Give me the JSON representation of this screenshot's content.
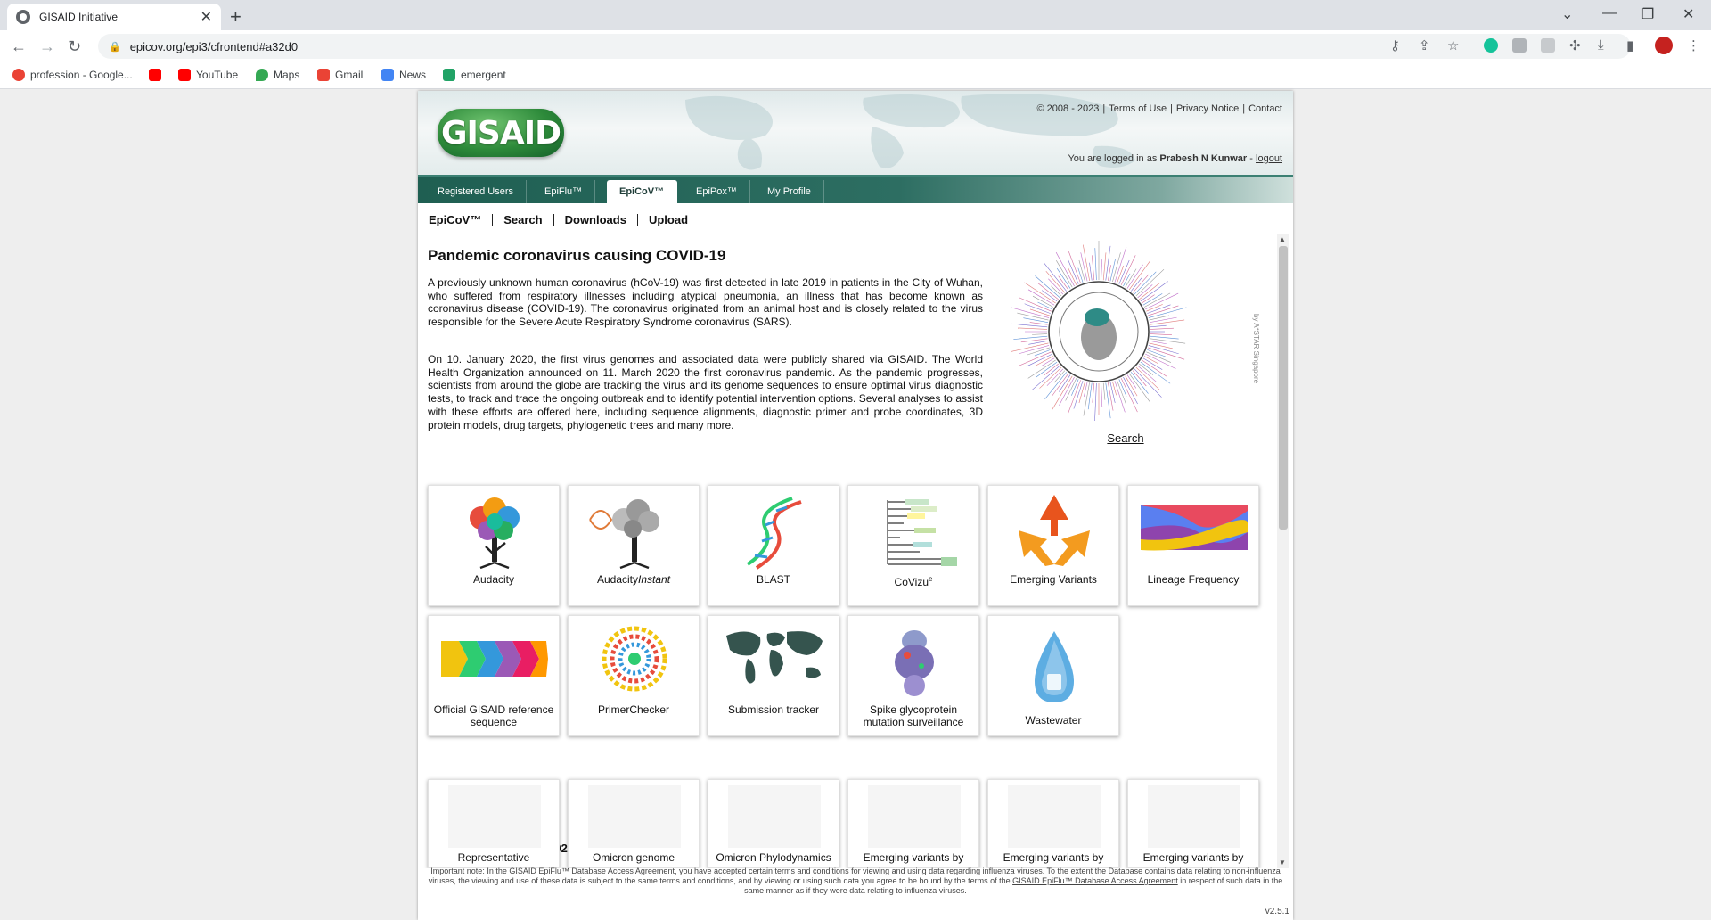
{
  "browser": {
    "tab_title": "GISAID Initiative",
    "url": "epicov.org/epi3/cfrontend#a32d0",
    "bookmarks": [
      {
        "label": "profession - Google...",
        "color": "#ea4335"
      },
      {
        "label": "",
        "color": "#ff0000"
      },
      {
        "label": "YouTube",
        "color": "#ff0000"
      },
      {
        "label": "Maps",
        "color": "#34a853"
      },
      {
        "label": "Gmail",
        "color": "#ea4335"
      },
      {
        "label": "News",
        "color": "#4285f4"
      },
      {
        "label": "emergent",
        "color": "#21a366"
      }
    ]
  },
  "header": {
    "logo": "GISAID",
    "copyright": "© 2008 - 2023",
    "terms": "Terms of Use",
    "privacy": "Privacy Notice",
    "contact": "Contact",
    "logged_in_prefix": "You are logged in as",
    "user": "Prabesh N Kunwar",
    "logout_sep": "-",
    "logout": "logout"
  },
  "nav": {
    "tabs": [
      "Registered Users",
      "EpiFlu™",
      "EpiCoV™",
      "EpiPox™",
      "My Profile"
    ],
    "active": "EpiCoV™"
  },
  "subnav": [
    "EpiCoV™",
    "Search",
    "Downloads",
    "Upload"
  ],
  "intro": {
    "heading": "Pandemic coronavirus causing COVID-19",
    "p1": "A previously unknown human coronavirus (hCoV-19) was first detected in late 2019 in patients in the City of Wuhan, who suffered from respiratory illnesses including atypical pneumonia, an illness that has become known as coronavirus disease (COVID-19). The coronavirus originated from an animal host and is closely related to the virus responsible for the Severe Acute Respiratory Syndrome coronavirus (SARS).",
    "p2": "On 10. January 2020, the first virus genomes and associated data were publicly shared via GISAID. The World Health Organization announced on 11. March 2020 the first coronavirus pandemic. As the pandemic progresses, scientists from around the globe are tracking the virus and its genome sequences to ensure optimal virus diagnostic tests, to track and trace the ongoing outbreak and to identify potential intervention options. Several analyses to assist with these efforts are offered here, including sequence alignments, diagnostic primer and probe coordinates, 3D protein models, drug targets, phylogenetic trees and many more.",
    "tree_credit": "by A*STAR Singapore",
    "tree_link": "Search"
  },
  "tools": [
    {
      "label": "Audacity",
      "icon": "audacity-tree-icon"
    },
    {
      "label": "AudacityInstant",
      "icon": "audacity-instant-icon"
    },
    {
      "label": "BLAST",
      "icon": "dna-helix-icon"
    },
    {
      "label": "CoVizu",
      "sup": "e",
      "icon": "covizu-tree-icon"
    },
    {
      "label": "Emerging Variants",
      "icon": "emerging-variants-icon"
    },
    {
      "label": "Lineage Frequency",
      "icon": "lineage-frequency-icon"
    },
    {
      "label": "Official GISAID reference sequence",
      "icon": "reference-sequence-icon"
    },
    {
      "label": "PrimerChecker",
      "icon": "primerchecker-icon"
    },
    {
      "label": "Submission tracker",
      "icon": "world-map-icon"
    },
    {
      "label": "Spike glycoprotein mutation surveillance",
      "icon": "spike-protein-icon"
    },
    {
      "label": "Wastewater",
      "icon": "water-drop-icon"
    }
  ],
  "analysis": {
    "heading": "Analysis Update (2023-02-22)",
    "items": [
      "Representative",
      "Omicron genome",
      "Omicron Phylodynamics",
      "Emerging variants by",
      "Emerging variants by",
      "Emerging variants by"
    ]
  },
  "footnote": {
    "pre": "Important note: In the",
    "link1": "GISAID EpiFlu™ Database Access Agreement",
    "mid": ", you have accepted certain terms and conditions for viewing and using data regarding influenza viruses. To the extent the Database contains data relating to non-influenza viruses, the viewing and use of these data is subject to the same terms and conditions, and by viewing or using such data you agree to be bound by the terms of the",
    "link2": "GISAID EpiFlu™ Database Access Agreement",
    "post": "in respect of such data in the same manner as if they were data relating to influenza viruses."
  },
  "version": "v2.5.1"
}
